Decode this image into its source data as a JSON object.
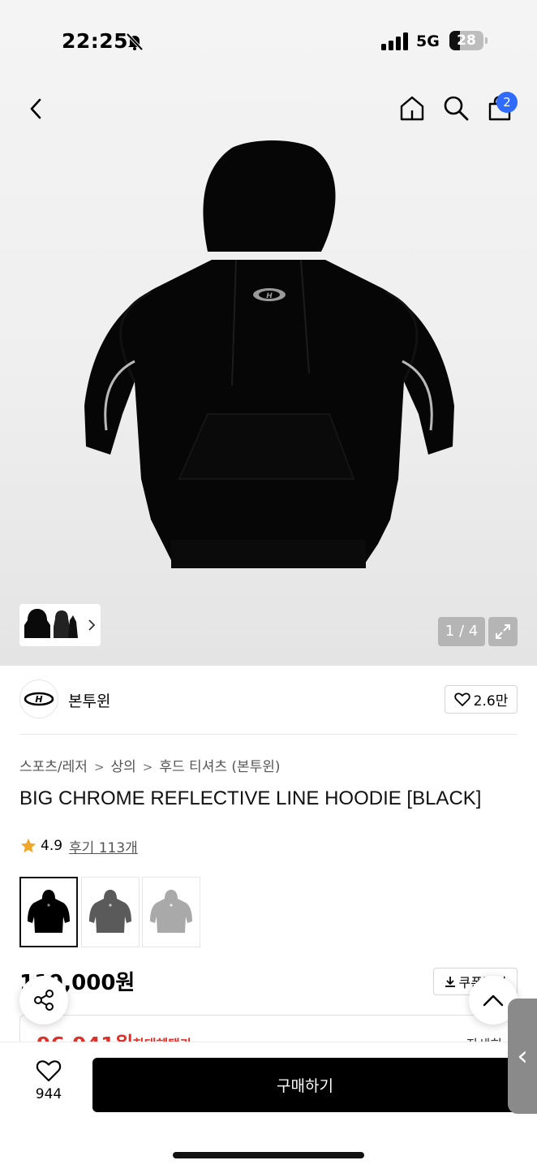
{
  "status_bar": {
    "time": "22:25",
    "network": "5G",
    "battery": "28"
  },
  "header": {
    "cart_count": "2"
  },
  "gallery": {
    "counter": "1 / 4"
  },
  "brand": {
    "name": "본투윈",
    "likes": "2.6만"
  },
  "breadcrumb": [
    "스포츠/레저",
    "상의",
    "후드 티셔츠 (본투윈)"
  ],
  "product": {
    "title": "BIG CHROME REFLECTIVE LINE HOODIE [BLACK]",
    "rating": "4.9",
    "reviews": "후기 113개",
    "price": "119,000원",
    "coupon_label": "쿠폰받기",
    "max_price": "96,941원",
    "max_label": "최대혜택가",
    "detail_label": "자세히"
  },
  "colors": [
    {
      "name": "black",
      "hex": "#000000"
    },
    {
      "name": "charcoal",
      "hex": "#5a5a5a"
    },
    {
      "name": "gray",
      "hex": "#a9a9a9"
    }
  ],
  "bottom_bar": {
    "wish_count": "944",
    "buy_label": "구매하기"
  },
  "accent": {
    "badge": "#2f6bff",
    "sale": "#e0302a",
    "star": "#f0a728"
  }
}
